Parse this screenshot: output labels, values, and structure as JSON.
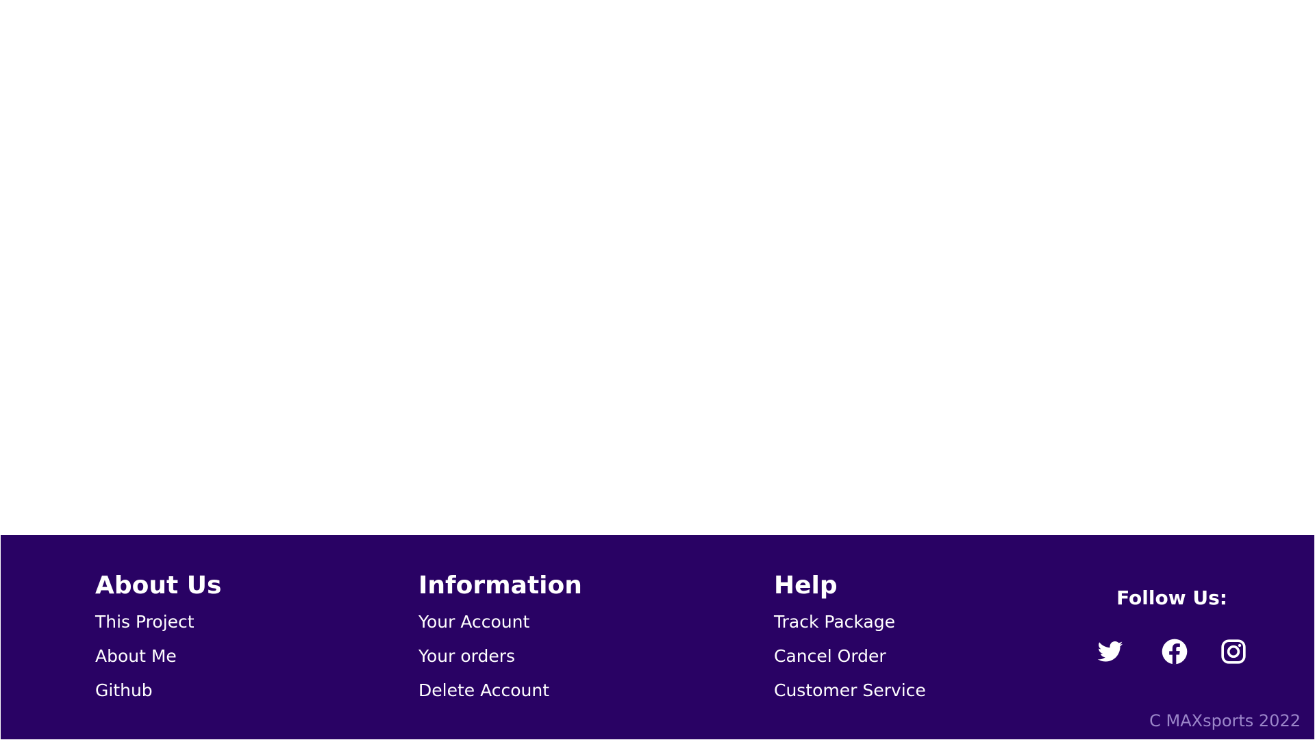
{
  "footer": {
    "about": {
      "heading": "About Us",
      "links": [
        "This Project",
        "About Me",
        "Github"
      ]
    },
    "information": {
      "heading": "Information",
      "links": [
        "Your Account",
        "Your orders",
        "Delete Account"
      ]
    },
    "help": {
      "heading": "Help",
      "links": [
        "Track Package",
        "Cancel Order",
        "Customer Service"
      ]
    },
    "follow": {
      "title": "Follow Us:",
      "icons": [
        "twitter-icon",
        "facebook-icon",
        "instagram-icon"
      ]
    },
    "copyright": "C MAXsports 2022",
    "colors": {
      "background": "#290264",
      "text": "#ffffff",
      "copyright": "#9b86c9"
    }
  }
}
